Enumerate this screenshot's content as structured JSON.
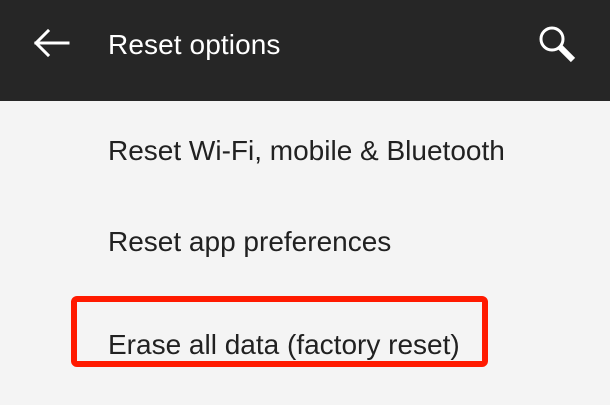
{
  "header": {
    "title": "Reset options",
    "back_icon": "arrow-back-icon",
    "search_icon": "search-icon",
    "background": "#262626"
  },
  "list": {
    "items": [
      {
        "label": "Reset Wi-Fi, mobile & Bluetooth"
      },
      {
        "label": "Reset app preferences"
      },
      {
        "label": "Erase all data (factory reset)",
        "highlighted": true
      }
    ]
  },
  "annotation": {
    "highlight_color": "#ff1a00"
  }
}
